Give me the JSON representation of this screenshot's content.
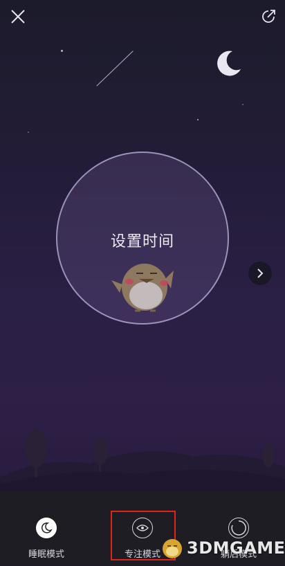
{
  "header": {
    "close_icon": "close-icon",
    "share_icon": "share-icon"
  },
  "timer": {
    "title": "设置时间"
  },
  "tabs": [
    {
      "label": "睡眠模式",
      "icon": "moon-icon"
    },
    {
      "label": "专注模式",
      "icon": "eye-icon"
    },
    {
      "label": "躺后模式",
      "icon": "ring-icon"
    }
  ],
  "watermark": {
    "text": "3DMGAME"
  },
  "colors": {
    "highlight": "#e0241b",
    "background": "#1b1a24",
    "tabbar": "#1e1d24"
  }
}
